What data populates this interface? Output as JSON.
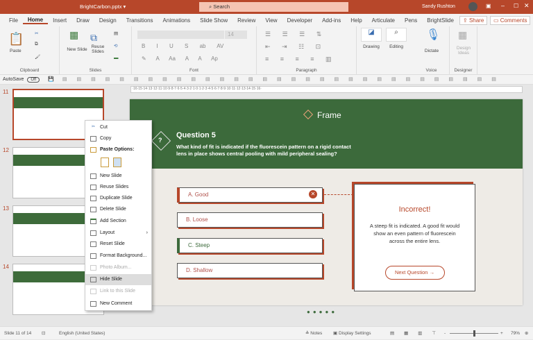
{
  "titlebar": {
    "file": "BrightCarbon.pptx ▾",
    "search": "Search",
    "user": "Sandy Rushton"
  },
  "tabs": [
    "File",
    "Home",
    "Insert",
    "Draw",
    "Design",
    "Transitions",
    "Animations",
    "Slide Show",
    "Review",
    "View",
    "Developer",
    "Add-ins",
    "Help",
    "Articulate",
    "Pens",
    "BrightSlide"
  ],
  "share": "Share",
  "comments": "Comments",
  "ribbon": {
    "paste": "Paste",
    "clipboard": "Clipboard",
    "new_slide": "New Slide",
    "reuse": "Reuse Slides",
    "slides": "Slides",
    "font_size": "14",
    "font": "Font",
    "paragraph": "Paragraph",
    "drawing": "Drawing",
    "editing": "Editing",
    "dictate": "Dictate",
    "voice": "Voice",
    "design_ideas": "Design Ideas",
    "designer": "Designer"
  },
  "qat": {
    "autosave": "AutoSave",
    "toggle": "Off"
  },
  "thumbnails": [
    "11",
    "12",
    "13",
    "14"
  ],
  "slide": {
    "logo": "Frame",
    "q_icon": "?",
    "question_title": "Question 5",
    "question_text": "What kind of fit is indicated if the fluorescein pattern on a rigid contact lens in place shows central pooling with mild peripheral sealing?",
    "options": [
      "A. Good",
      "B. Loose",
      "C. Steep",
      "D. Shallow"
    ],
    "feedback_title": "Incorrect!",
    "feedback_text": "A steep fit is indicated. A good fit would show an even pattern of fluorescein across the entire lens.",
    "next": "Next Question"
  },
  "menu": {
    "cut": "Cut",
    "copy": "Copy",
    "paste_options": "Paste Options:",
    "new_slide": "New Slide",
    "reuse": "Reuse Slides",
    "duplicate": "Duplicate Slide",
    "delete": "Delete Slide",
    "add_section": "Add Section",
    "layout": "Layout",
    "reset": "Reset Slide",
    "format_bg": "Format Background...",
    "photo_album": "Photo Album...",
    "hide": "Hide Slide",
    "link": "Link to this Slide",
    "new_comment": "New Comment"
  },
  "status": {
    "slide": "Slide 11 of 14",
    "lang": "English (United States)",
    "notes": "Notes",
    "display": "Display Settings",
    "zoom": "79%"
  },
  "colors": {
    "accent": "#b7472a",
    "green": "#3c6a3b"
  }
}
